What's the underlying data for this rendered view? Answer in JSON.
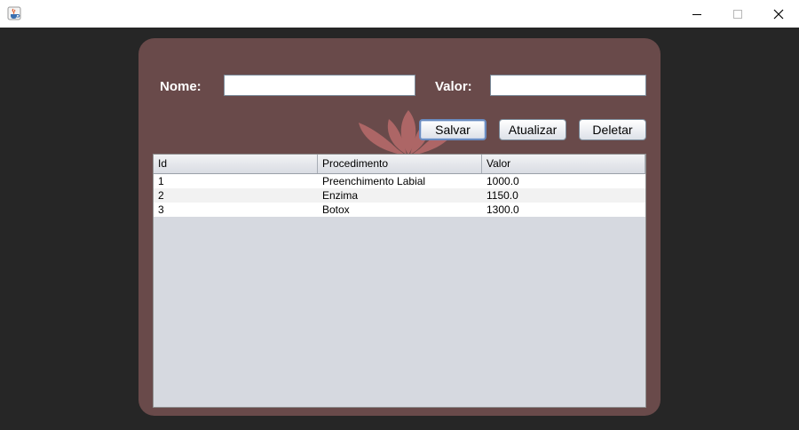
{
  "window": {
    "title": "",
    "icon": "java-cup-icon",
    "controls": [
      "minimize-icon",
      "maximize-icon",
      "close-icon"
    ]
  },
  "colors": {
    "desktop": "#262626",
    "panel": "#694a4a",
    "table_empty": "#d6d9e0",
    "lotus": "#b96b6b"
  },
  "form": {
    "nome_label": "Nome:",
    "nome_value": "",
    "valor_label": "Valor:",
    "valor_value": ""
  },
  "buttons": {
    "salvar": "Salvar",
    "atualizar": "Atualizar",
    "deletar": "Deletar"
  },
  "table": {
    "columns": [
      "Id",
      "Procedimento",
      "Valor"
    ],
    "rows": [
      [
        "1",
        "Preenchimento Labial",
        "1000.0"
      ],
      [
        "2",
        "Enzima",
        "1150.0"
      ],
      [
        "3",
        "Botox",
        "1300.0"
      ]
    ]
  }
}
